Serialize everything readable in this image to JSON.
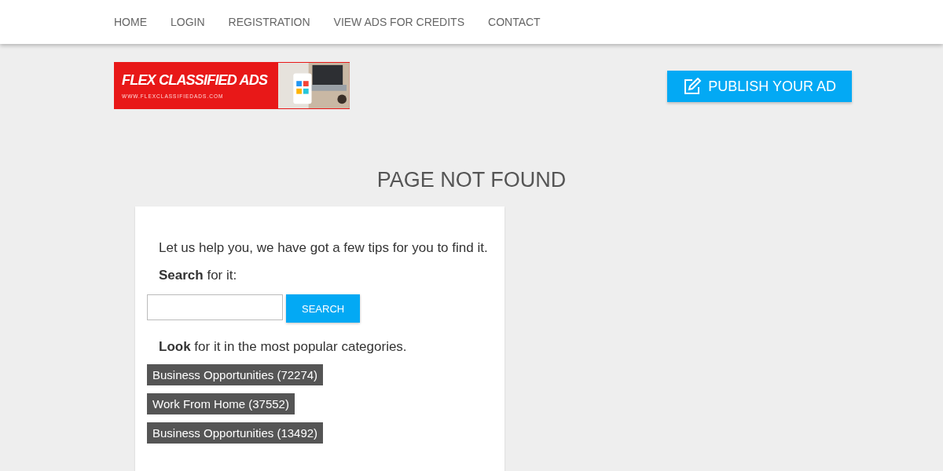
{
  "nav": {
    "items": [
      {
        "label": "HOME"
      },
      {
        "label": "LOGIN"
      },
      {
        "label": "REGISTRATION"
      },
      {
        "label": "VIEW ADS FOR CREDITS"
      },
      {
        "label": "CONTACT"
      }
    ]
  },
  "logo": {
    "title": "FLEX CLASSIFIED ADS",
    "url": "WWW.FLEXCLASSIFIEDADS.COM"
  },
  "publish_button": {
    "label": "PUBLISH YOUR AD"
  },
  "page_title": "PAGE NOT FOUND",
  "card": {
    "intro": "Let us help you, we have got a few tips for you to find it.",
    "search_prompt": "**Search** for it:",
    "search_button": "SEARCH",
    "look_prompt": "**Look** for it in the most popular categories.",
    "categories": [
      {
        "label": "Business Opportunities (72274)"
      },
      {
        "label": "Work From Home (37552)"
      },
      {
        "label": "Business Opportunities (13492)"
      }
    ]
  }
}
